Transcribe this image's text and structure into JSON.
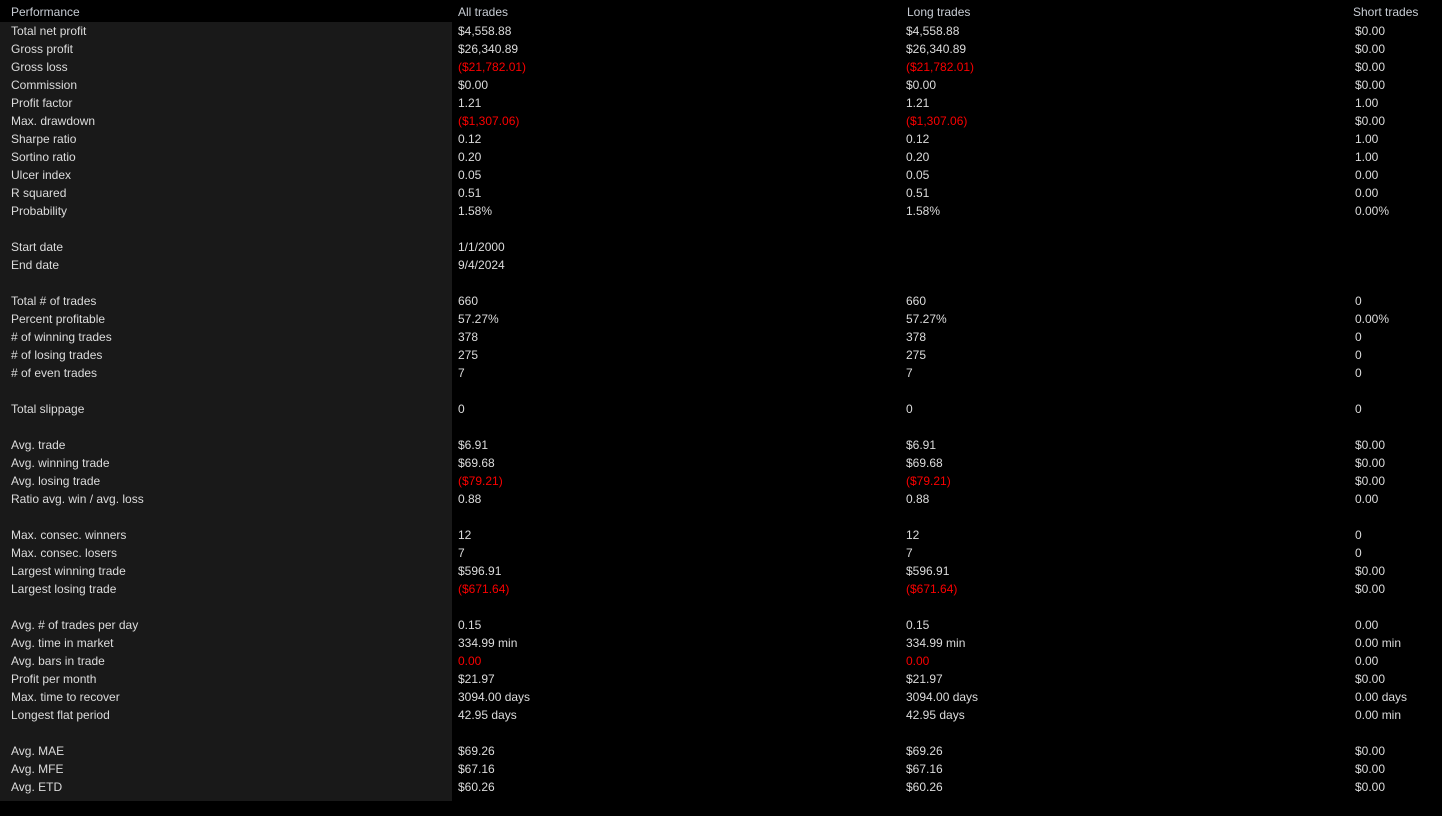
{
  "header": {
    "performance": "Performance",
    "all_trades": "All trades",
    "long_trades": "Long trades",
    "short_trades": "Short trades"
  },
  "colors": {
    "background": "#000000",
    "panel": "#191919",
    "text": "#dcdcdc",
    "header_text": "#c8cdd4",
    "negative": "#fb0000"
  },
  "rows": [
    {
      "label": "Total net profit",
      "all": "$4,558.88",
      "long": "$4,558.88",
      "short": "$0.00"
    },
    {
      "label": "Gross profit",
      "all": "$26,340.89",
      "long": "$26,340.89",
      "short": "$0.00"
    },
    {
      "label": "Gross loss",
      "all": "($21,782.01)",
      "long": "($21,782.01)",
      "short": "$0.00",
      "all_neg": true,
      "long_neg": true
    },
    {
      "label": "Commission",
      "all": "$0.00",
      "long": "$0.00",
      "short": "$0.00"
    },
    {
      "label": "Profit factor",
      "all": "1.21",
      "long": "1.21",
      "short": "1.00"
    },
    {
      "label": "Max. drawdown",
      "all": "($1,307.06)",
      "long": "($1,307.06)",
      "short": "$0.00",
      "all_neg": true,
      "long_neg": true
    },
    {
      "label": "Sharpe ratio",
      "all": "0.12",
      "long": "0.12",
      "short": "1.00"
    },
    {
      "label": "Sortino ratio",
      "all": "0.20",
      "long": "0.20",
      "short": "1.00"
    },
    {
      "label": "Ulcer index",
      "all": "0.05",
      "long": "0.05",
      "short": "0.00"
    },
    {
      "label": "R squared",
      "all": "0.51",
      "long": "0.51",
      "short": "0.00"
    },
    {
      "label": "Probability",
      "all": "1.58%",
      "long": "1.58%",
      "short": "0.00%"
    },
    {
      "spacer": true
    },
    {
      "label": "Start date",
      "all": "1/1/2000",
      "long": "",
      "short": ""
    },
    {
      "label": "End date",
      "all": "9/4/2024",
      "long": "",
      "short": ""
    },
    {
      "spacer": true
    },
    {
      "label": "Total # of trades",
      "all": "660",
      "long": "660",
      "short": "0"
    },
    {
      "label": "Percent profitable",
      "all": "57.27%",
      "long": "57.27%",
      "short": "0.00%"
    },
    {
      "label": "# of winning trades",
      "all": "378",
      "long": "378",
      "short": "0"
    },
    {
      "label": "# of losing trades",
      "all": "275",
      "long": "275",
      "short": "0"
    },
    {
      "label": "# of even trades",
      "all": "7",
      "long": "7",
      "short": "0"
    },
    {
      "spacer": true
    },
    {
      "label": "Total slippage",
      "all": "0",
      "long": "0",
      "short": "0"
    },
    {
      "spacer": true
    },
    {
      "label": "Avg. trade",
      "all": "$6.91",
      "long": "$6.91",
      "short": "$0.00"
    },
    {
      "label": "Avg. winning trade",
      "all": "$69.68",
      "long": "$69.68",
      "short": "$0.00"
    },
    {
      "label": "Avg. losing trade",
      "all": "($79.21)",
      "long": "($79.21)",
      "short": "$0.00",
      "all_neg": true,
      "long_neg": true
    },
    {
      "label": "Ratio avg. win / avg. loss",
      "all": "0.88",
      "long": "0.88",
      "short": "0.00"
    },
    {
      "spacer": true
    },
    {
      "label": "Max. consec. winners",
      "all": "12",
      "long": "12",
      "short": "0"
    },
    {
      "label": "Max. consec. losers",
      "all": "7",
      "long": "7",
      "short": "0"
    },
    {
      "label": "Largest winning trade",
      "all": "$596.91",
      "long": "$596.91",
      "short": "$0.00"
    },
    {
      "label": "Largest losing trade",
      "all": "($671.64)",
      "long": "($671.64)",
      "short": "$0.00",
      "all_neg": true,
      "long_neg": true
    },
    {
      "spacer": true
    },
    {
      "label": "Avg. # of trades per day",
      "all": "0.15",
      "long": "0.15",
      "short": "0.00"
    },
    {
      "label": "Avg. time in market",
      "all": "334.99 min",
      "long": "334.99 min",
      "short": "0.00 min"
    },
    {
      "label": "Avg. bars in trade",
      "all": "0.00",
      "long": "0.00",
      "short": "0.00",
      "all_neg": true,
      "long_neg": true
    },
    {
      "label": "Profit per month",
      "all": "$21.97",
      "long": "$21.97",
      "short": "$0.00"
    },
    {
      "label": "Max. time to recover",
      "all": "3094.00 days",
      "long": "3094.00 days",
      "short": "0.00 days"
    },
    {
      "label": "Longest flat period",
      "all": "42.95 days",
      "long": "42.95 days",
      "short": "0.00 min"
    },
    {
      "spacer": true
    },
    {
      "label": "Avg. MAE",
      "all": "$69.26",
      "long": "$69.26",
      "short": "$0.00"
    },
    {
      "label": "Avg. MFE",
      "all": "$67.16",
      "long": "$67.16",
      "short": "$0.00"
    },
    {
      "label": "Avg. ETD",
      "all": "$60.26",
      "long": "$60.26",
      "short": "$0.00"
    }
  ]
}
